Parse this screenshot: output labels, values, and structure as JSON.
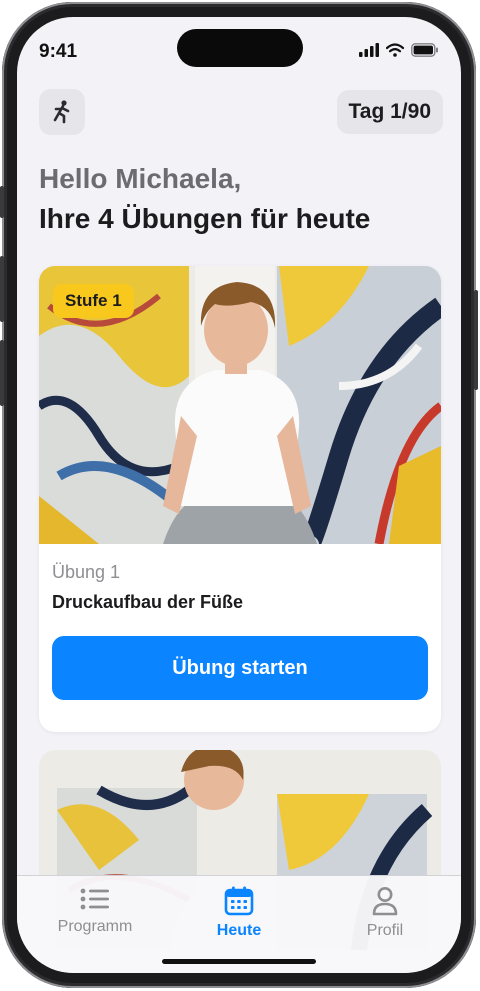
{
  "status_bar": {
    "time": "9:41"
  },
  "header": {
    "activity_icon": "exercise-figure-icon",
    "day_badge": "Tag 1/90"
  },
  "greeting": {
    "hello": "Hello Michaela,",
    "subtitle": "Ihre 4 Übungen für heute"
  },
  "exercise_cards": [
    {
      "level_badge": "Stufe 1",
      "number_label": "Übung 1",
      "title": "Druckaufbau der Füße",
      "start_button": "Übung starten"
    }
  ],
  "tabbar": {
    "tabs": [
      {
        "label": "Programm",
        "icon": "list-icon",
        "active": false
      },
      {
        "label": "Heute",
        "icon": "calendar-icon",
        "active": true
      },
      {
        "label": "Profil",
        "icon": "person-icon",
        "active": false
      }
    ]
  },
  "colors": {
    "accent": "#0a84ff",
    "level_badge": "#f8c81c",
    "background": "#f2f2f7"
  }
}
